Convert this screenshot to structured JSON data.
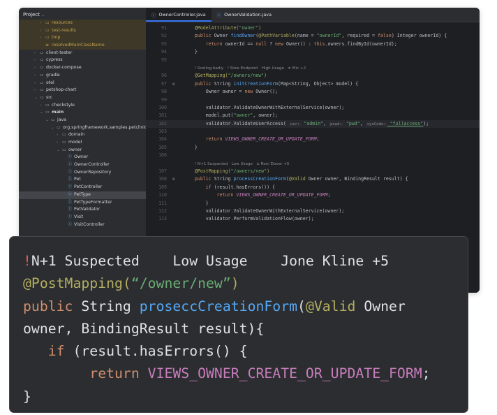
{
  "sidebar": {
    "title": "Project",
    "items": [
      {
        "label": "resources",
        "indent": 2,
        "arrow": "›",
        "icon": "folder",
        "cls": "excl"
      },
      {
        "label": "test-results",
        "indent": 2,
        "arrow": "›",
        "icon": "folder",
        "cls": "excl"
      },
      {
        "label": "tmp",
        "indent": 2,
        "arrow": "›",
        "icon": "folder",
        "cls": "excl"
      },
      {
        "label": "resolvedMainClassName",
        "indent": 2,
        "arrow": "",
        "icon": "file",
        "cls": "excl"
      },
      {
        "label": "client-tester",
        "indent": 1,
        "arrow": "›",
        "icon": "folder",
        "cls": ""
      },
      {
        "label": "cypress",
        "indent": 1,
        "arrow": "›",
        "icon": "folder",
        "cls": ""
      },
      {
        "label": "docker-compose",
        "indent": 1,
        "arrow": "›",
        "icon": "folder",
        "cls": ""
      },
      {
        "label": "gradle",
        "indent": 1,
        "arrow": "›",
        "icon": "folder",
        "cls": ""
      },
      {
        "label": "otel",
        "indent": 1,
        "arrow": "›",
        "icon": "folder",
        "cls": ""
      },
      {
        "label": "petshop-chart",
        "indent": 1,
        "arrow": "›",
        "icon": "folder",
        "cls": ""
      },
      {
        "label": "src",
        "indent": 1,
        "arrow": "⌄",
        "icon": "folder",
        "cls": ""
      },
      {
        "label": "checkstyle",
        "indent": 2,
        "arrow": "›",
        "icon": "folder",
        "cls": ""
      },
      {
        "label": "main",
        "indent": 2,
        "arrow": "⌄",
        "icon": "folder",
        "cls": "bold"
      },
      {
        "label": "java",
        "indent": 3,
        "arrow": "⌄",
        "icon": "folder",
        "cls": ""
      },
      {
        "label": "org.springframework.samples.petclinic",
        "indent": 4,
        "arrow": "⌄",
        "icon": "folder",
        "cls": ""
      },
      {
        "label": "domain",
        "indent": 5,
        "arrow": "›",
        "icon": "folder",
        "cls": ""
      },
      {
        "label": "model",
        "indent": 5,
        "arrow": "›",
        "icon": "folder",
        "cls": ""
      },
      {
        "label": "owner",
        "indent": 5,
        "arrow": "⌄",
        "icon": "folder",
        "cls": ""
      },
      {
        "label": "Owner",
        "indent": 6,
        "arrow": "",
        "icon": "class",
        "cls": ""
      },
      {
        "label": "OwnerController",
        "indent": 6,
        "arrow": "",
        "icon": "class",
        "cls": ""
      },
      {
        "label": "OwnerRepository",
        "indent": 6,
        "arrow": "",
        "icon": "iface",
        "cls": ""
      },
      {
        "label": "Pet",
        "indent": 6,
        "arrow": "",
        "icon": "class",
        "cls": ""
      },
      {
        "label": "PetController",
        "indent": 6,
        "arrow": "",
        "icon": "class",
        "cls": ""
      },
      {
        "label": "PetType",
        "indent": 6,
        "arrow": "",
        "icon": "class",
        "cls": "sel"
      },
      {
        "label": "PetTypeFormatter",
        "indent": 6,
        "arrow": "",
        "icon": "class",
        "cls": ""
      },
      {
        "label": "PetValidator",
        "indent": 6,
        "arrow": "",
        "icon": "class",
        "cls": ""
      },
      {
        "label": "Visit",
        "indent": 6,
        "arrow": "",
        "icon": "class",
        "cls": ""
      },
      {
        "label": "VisitController",
        "indent": 6,
        "arrow": "",
        "icon": "class",
        "cls": ""
      }
    ]
  },
  "tabs": [
    {
      "label": "OwnerController.java",
      "active": true
    },
    {
      "label": "OwnerValidation.java",
      "active": false
    }
  ],
  "code": [
    {
      "n": "91",
      "g": "",
      "tokens": [
        [
          "ann",
          "@ModelAttribute("
        ],
        [
          "str",
          "\"owner\""
        ],
        [
          "ann",
          ")"
        ]
      ],
      "ind": 4
    },
    {
      "n": "92",
      "g": "",
      "tokens": [
        [
          "kw",
          "public "
        ],
        [
          "txt",
          "Owner "
        ],
        [
          "fn",
          "findOwner"
        ],
        [
          "txt",
          "("
        ],
        [
          "ann",
          "@PathVariable"
        ],
        [
          "txt",
          "(name = "
        ],
        [
          "str",
          "\"ownerId\""
        ],
        [
          "txt",
          ", required = "
        ],
        [
          "kw",
          "false"
        ],
        [
          "txt",
          ") Integer ownerId) {"
        ]
      ],
      "ind": 4
    },
    {
      "n": "93",
      "g": "",
      "tokens": [
        [
          "kw",
          "return "
        ],
        [
          "txt",
          "ownerId == "
        ],
        [
          "kw",
          "null"
        ],
        [
          "txt",
          " ? "
        ],
        [
          "kw",
          "new "
        ],
        [
          "txt",
          "Owner() : "
        ],
        [
          "kw",
          "this"
        ],
        [
          "txt",
          ".owners.findById(ownerId);"
        ]
      ],
      "ind": 8
    },
    {
      "n": "94",
      "g": "",
      "tokens": [
        [
          "txt",
          "}"
        ]
      ],
      "ind": 4
    },
    {
      "n": "95",
      "g": "",
      "tokens": [],
      "ind": 0
    },
    {
      "n": "",
      "g": "",
      "insp": [
        [
          "bang",
          "! "
        ],
        [
          "insp",
          "Scaling badly   "
        ],
        [
          "bang",
          "! "
        ],
        [
          "insp",
          "Slow Endpoint   High Usage   ± Mic +2"
        ]
      ],
      "ind": 4
    },
    {
      "n": "96",
      "g": "",
      "tokens": [
        [
          "ann",
          "@GetMapping("
        ],
        [
          "str",
          "\"/owners/new\""
        ],
        [
          "ann",
          ")"
        ]
      ],
      "ind": 4
    },
    {
      "n": "97",
      "g": "⊕",
      "tokens": [
        [
          "kw",
          "public "
        ],
        [
          "txt",
          "String "
        ],
        [
          "fn",
          "initCreationForm"
        ],
        [
          "txt",
          "(Map<String, Object> model) {"
        ]
      ],
      "ind": 4
    },
    {
      "n": "98",
      "g": "",
      "tokens": [
        [
          "txt",
          "Owner owner = "
        ],
        [
          "kw",
          "new "
        ],
        [
          "txt",
          "Owner();"
        ]
      ],
      "ind": 8
    },
    {
      "n": "99",
      "g": "",
      "tokens": [],
      "ind": 0
    },
    {
      "n": "100",
      "g": "",
      "tokens": [
        [
          "txt",
          "validator.ValidateOwnerWithExternalService(owner);"
        ]
      ],
      "ind": 8
    },
    {
      "n": "101",
      "g": "",
      "tokens": [
        [
          "txt",
          "model.put("
        ],
        [
          "str",
          "\"owner\""
        ],
        [
          "txt",
          ", owner);"
        ]
      ],
      "ind": 8
    },
    {
      "n": "102",
      "g": "",
      "cur": true,
      "tokens": [
        [
          "txt",
          "validator.ValidateUserAccess( "
        ],
        [
          "hint",
          "usr:"
        ],
        [
          "str",
          " \"admin\""
        ],
        [
          "txt",
          ", "
        ],
        [
          "hint",
          "pswd:"
        ],
        [
          "str",
          " \"pwd\""
        ],
        [
          "txt",
          ", "
        ],
        [
          "hint",
          "sysCode:"
        ],
        [
          "str und",
          " \"fullaccess\""
        ],
        [
          "txt",
          ");"
        ]
      ],
      "ind": 8
    },
    {
      "n": "103",
      "g": "",
      "tokens": [],
      "ind": 0
    },
    {
      "n": "104",
      "g": "",
      "tokens": [
        [
          "kw",
          "return "
        ],
        [
          "const",
          "VIEWS_OWNER_CREATE_OR_UPDATE_FORM"
        ],
        [
          "txt",
          ";"
        ]
      ],
      "ind": 8
    },
    {
      "n": "105",
      "g": "",
      "tokens": [
        [
          "txt",
          "}"
        ]
      ],
      "ind": 4
    },
    {
      "n": "106",
      "g": "",
      "tokens": [],
      "ind": 0
    },
    {
      "n": "",
      "g": "",
      "insp": [
        [
          "bang",
          "! "
        ],
        [
          "insp",
          "N+1 Suspected   Low Usage   ± Roni Dover +5"
        ]
      ],
      "ind": 4
    },
    {
      "n": "107",
      "g": "",
      "tokens": [
        [
          "ann",
          "@PostMapping("
        ],
        [
          "str",
          "\"/owners/new\""
        ],
        [
          "ann",
          ")"
        ]
      ],
      "ind": 4
    },
    {
      "n": "108",
      "g": "⊕",
      "tokens": [
        [
          "kw",
          "public "
        ],
        [
          "txt",
          "String "
        ],
        [
          "fn",
          "processCreationForm"
        ],
        [
          "txt",
          "("
        ],
        [
          "ann",
          "@Valid "
        ],
        [
          "txt",
          "Owner owner, BindingResult result) {"
        ]
      ],
      "ind": 4
    },
    {
      "n": "109",
      "g": "",
      "tokens": [
        [
          "kw",
          "if "
        ],
        [
          "txt",
          "(result.hasErrors()) {"
        ]
      ],
      "ind": 8
    },
    {
      "n": "110",
      "g": "",
      "tokens": [
        [
          "kw",
          "return "
        ],
        [
          "const",
          "VIEWS_OWNER_CREATE_OR_UPDATE_FORM"
        ],
        [
          "txt",
          ";"
        ]
      ],
      "ind": 12
    },
    {
      "n": "111",
      "g": "",
      "tokens": [
        [
          "txt",
          "}"
        ]
      ],
      "ind": 8
    },
    {
      "n": "112",
      "g": "",
      "tokens": [
        [
          "txt",
          "validator.ValidateOwnerWithExternalService(owner);"
        ]
      ],
      "ind": 8
    },
    {
      "n": "113",
      "g": "",
      "tokens": [
        [
          "txt",
          "validator.PerformValidationFlow(owner);"
        ]
      ],
      "ind": 8
    }
  ],
  "overlay": {
    "lines": [
      [
        [
          "ov-bang",
          "!"
        ],
        [
          "ov-gray",
          "N+1 Suspected    Low Usage    Jone Kline +5"
        ]
      ],
      [
        [
          "ann",
          "@PostMapping("
        ],
        [
          "str",
          "“/owner/new”"
        ],
        [
          "ann",
          ")"
        ]
      ],
      [
        [
          "kw",
          "public "
        ],
        [
          "ov-gray",
          "String "
        ],
        [
          "fn",
          "proseccCreationForm"
        ],
        [
          "ov-gray",
          "("
        ],
        [
          "ann",
          "@Valid "
        ],
        [
          "ov-gray",
          "Owner"
        ]
      ],
      [
        [
          "ov-gray",
          "owner, BindingResult result){"
        ]
      ],
      [
        [
          "ov-gray",
          "   "
        ],
        [
          "kw",
          "if "
        ],
        [
          "ov-gray",
          "(result.hasErrors() {"
        ]
      ],
      [
        [
          "ov-gray",
          "        "
        ],
        [
          "kw",
          "return "
        ],
        [
          "const-ov",
          "VIEWS_OWNER_CREATE_OR_UPDATE_FORM"
        ],
        [
          "ov-gray",
          ";"
        ]
      ],
      [
        [
          "ov-gray",
          "}"
        ]
      ]
    ]
  }
}
